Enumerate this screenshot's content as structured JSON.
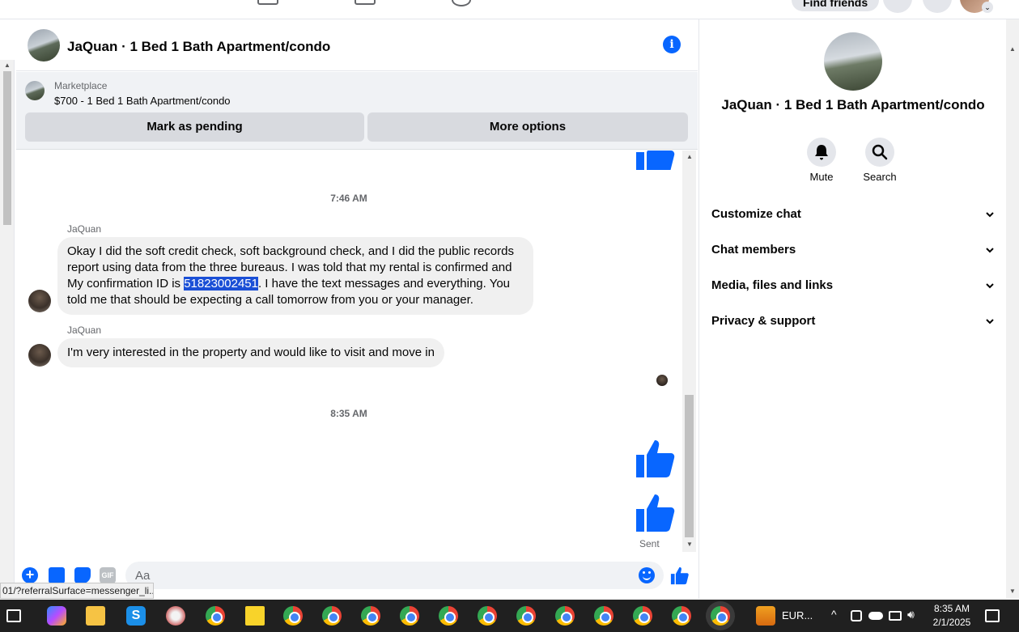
{
  "topnav": {
    "find_friends_label": "Find friends"
  },
  "chat_header": {
    "title": "JaQuan · 1 Bed 1 Bath Apartment/condo"
  },
  "marketplace": {
    "label": "Marketplace",
    "listing": "$700 - 1 Bed 1 Bath Apartment/condo",
    "mark_pending_label": "Mark as pending",
    "more_options_label": "More options"
  },
  "messages": {
    "timestamp_1": "7:46 AM",
    "msg1": {
      "sender": "JaQuan",
      "text_before": "Okay I did the soft credit check, soft background check, and I did the public records report using data from the three bureaus. I was told that my rental is confirmed and My confirmation ID is ",
      "highlight": "51823002451",
      "text_after": ". I have the text messages and everything. You told me that should be expecting a call tomorrow from you or your manager."
    },
    "msg2": {
      "sender": "JaQuan",
      "text": "I'm very interested in the property and would like to visit and move in"
    },
    "timestamp_2": "8:35 AM",
    "sent_label": "Sent"
  },
  "composer": {
    "placeholder": "Aa",
    "gif_label": "GIF"
  },
  "status_url": "01/?referralSurface=messenger_li...",
  "right_panel": {
    "title": "JaQuan · 1 Bed 1 Bath Apartment/condo",
    "actions": {
      "mute": "Mute",
      "search": "Search"
    },
    "sections": [
      "Customize chat",
      "Chat members",
      "Media, files and links",
      "Privacy & support"
    ]
  },
  "taskbar": {
    "tray_label": "EUR...",
    "time": "8:35 AM",
    "date": "2/1/2025"
  },
  "colors": {
    "accent": "#0866ff",
    "bubble": "#f0f0f0",
    "taskbar": "#202020"
  },
  "icons": [
    "info-icon",
    "thumbs-up-icon",
    "plus-icon",
    "photo-icon",
    "sticker-icon",
    "gif-icon",
    "emoji-icon",
    "bell-icon",
    "search-icon",
    "chevron-down-icon",
    "chrome-icon"
  ]
}
